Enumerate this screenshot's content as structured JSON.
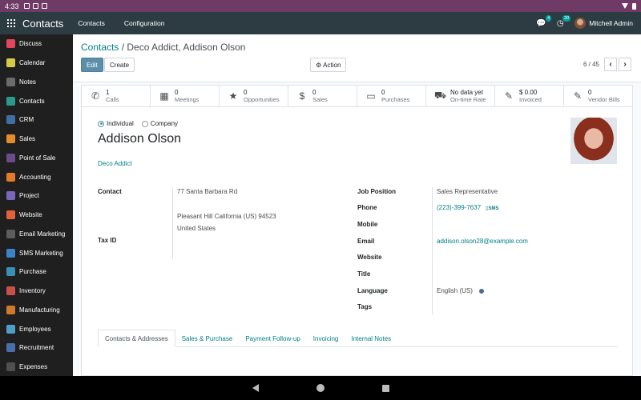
{
  "status": {
    "time": "4:33"
  },
  "topnav": {
    "brand": "Contacts",
    "menus": [
      "Contacts",
      "Configuration"
    ],
    "chat_count": "4",
    "activity_count": "30",
    "user_name": "Mitchell Admin"
  },
  "sidebar": {
    "items": [
      {
        "label": "Discuss",
        "color": "#e2465a",
        "icon": "discuss-icon"
      },
      {
        "label": "Calendar",
        "color": "#d6c94a",
        "icon": "calendar-icon"
      },
      {
        "label": "Notes",
        "color": "#6b6b6b",
        "icon": "notes-icon"
      },
      {
        "label": "Contacts",
        "color": "#2a9a8c",
        "icon": "contacts-icon"
      },
      {
        "label": "CRM",
        "color": "#3f6ea3",
        "icon": "crm-icon"
      },
      {
        "label": "Sales",
        "color": "#e48b2a",
        "icon": "sales-icon"
      },
      {
        "label": "Point of Sale",
        "color": "#6d4a8a",
        "icon": "pos-icon"
      },
      {
        "label": "Accounting",
        "color": "#e47a2a",
        "icon": "accounting-icon"
      },
      {
        "label": "Project",
        "color": "#7a66b8",
        "icon": "project-icon"
      },
      {
        "label": "Website",
        "color": "#e2613a",
        "icon": "website-icon"
      },
      {
        "label": "Email Marketing",
        "color": "#5c5c5c",
        "icon": "email-marketing-icon"
      },
      {
        "label": "SMS Marketing",
        "color": "#3b83c9",
        "icon": "sms-marketing-icon"
      },
      {
        "label": "Purchase",
        "color": "#3a8fb5",
        "icon": "purchase-icon"
      },
      {
        "label": "Inventory",
        "color": "#c9504a",
        "icon": "inventory-icon"
      },
      {
        "label": "Manufacturing",
        "color": "#cf7a2a",
        "icon": "manufacturing-icon"
      },
      {
        "label": "Employees",
        "color": "#4f9ec9",
        "icon": "employees-icon"
      },
      {
        "label": "Recruitment",
        "color": "#4a6fa8",
        "icon": "recruitment-icon"
      },
      {
        "label": "Expenses",
        "color": "#4f4f4f",
        "icon": "expenses-icon"
      }
    ]
  },
  "breadcrumb": {
    "parent": "Contacts",
    "separator": " / ",
    "current": "Deco Addict, Addison Olson"
  },
  "buttons": {
    "edit": "Edit",
    "create": "Create",
    "action": "Action"
  },
  "pager": {
    "text": "6 / 45"
  },
  "smart_buttons": [
    {
      "value": "1",
      "label": "Calls",
      "icon": "phone-icon",
      "glyph": "✆"
    },
    {
      "value": "0",
      "label": "Meetings",
      "icon": "calendar-icon",
      "glyph": "▦"
    },
    {
      "value": "0",
      "label": "Opportunities",
      "icon": "star-icon",
      "glyph": "★"
    },
    {
      "value": "0",
      "label": "Sales",
      "icon": "dollar-icon",
      "glyph": "$"
    },
    {
      "value": "0",
      "label": "Purchases",
      "icon": "credit-card-icon",
      "glyph": "▭"
    },
    {
      "value": "No data yet",
      "label": "On-time Rate",
      "icon": "truck-icon",
      "glyph": "⛟"
    },
    {
      "value": "$ 0.00",
      "label": "Invoiced",
      "icon": "edit-icon",
      "glyph": "✎"
    },
    {
      "value": "0",
      "label": "Vendor Bills",
      "icon": "edit-icon",
      "glyph": "✎"
    }
  ],
  "partner_type": {
    "individual": "Individual",
    "company": "Company",
    "selected": "Individual"
  },
  "partner": {
    "name": "Addison Olson",
    "company": "Deco Addict",
    "address_street": "77 Santa Barbara Rd",
    "address_city_line": "Pleasant Hill  California (US)  94523",
    "address_country": "United States"
  },
  "labels": {
    "contact": "Contact",
    "tax_id": "Tax ID",
    "job_position": "Job Position",
    "phone": "Phone",
    "mobile": "Mobile",
    "email": "Email",
    "website": "Website",
    "title": "Title",
    "language": "Language",
    "tags": "Tags"
  },
  "values": {
    "job_position": "Sales Representative",
    "phone": "(223)-399-7637",
    "sms": "SMS",
    "email": "addison.olson28@example.com",
    "language": "English (US)"
  },
  "tabs": [
    "Contacts & Addresses",
    "Sales & Purchase",
    "Payment Follow-up",
    "Invoicing",
    "Internal Notes"
  ]
}
